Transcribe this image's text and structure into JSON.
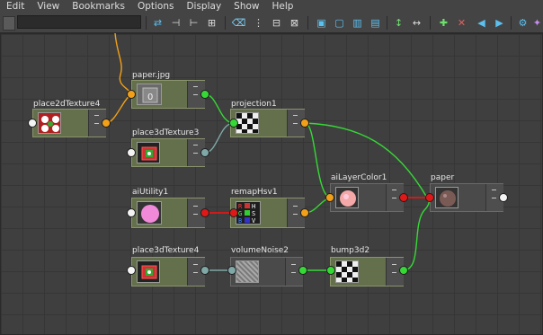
{
  "menubar": {
    "items": [
      "Edit",
      "View",
      "Bookmarks",
      "Options",
      "Display",
      "Show",
      "Help"
    ]
  },
  "toolbar": {
    "search_value": "",
    "icons": [
      "hypershade-swap-icon",
      "input-connections-icon",
      "output-connections-icon",
      "in-out-connections-icon",
      "clear-graph-icon",
      "rearrange-graph-icon",
      "graph-materials-icon",
      "graph-selection-icon",
      "show-inputs-icon",
      "show-outputs-icon",
      "show-both-icon",
      "show-none-icon",
      "align-vertical-icon",
      "align-horizontal-icon",
      "bookmark-add-icon",
      "bookmark-list-icon",
      "previous-view-icon",
      "next-view-icon",
      "frame-all-icon",
      "frame-selection-icon"
    ]
  },
  "nodes": [
    {
      "id": "paper_jpg",
      "title": "paper.jpg",
      "swatch": "file-image-swatch",
      "port_colors": {
        "in": "#f2a019",
        "out": "#36d836"
      }
    },
    {
      "id": "place2dTexture4",
      "title": "place2dTexture4",
      "swatch": "place2d-swatch",
      "port_colors": {
        "in": "#f4f4f4",
        "out": "#f2a019"
      }
    },
    {
      "id": "projection1",
      "title": "projection1",
      "swatch": "checker-swatch",
      "port_colors": {
        "in": "#36d836",
        "out": "#f2a019"
      }
    },
    {
      "id": "place3dTexture3",
      "title": "place3dTexture3",
      "swatch": "place3d-swatch",
      "port_colors": {
        "in": "#f4f4f4",
        "out": "#7fa8a6"
      }
    },
    {
      "id": "aiUtility1",
      "title": "aiUtility1",
      "swatch": "pink-sphere-swatch",
      "port_colors": {
        "in": "#f4f4f4",
        "out": "#e01818"
      }
    },
    {
      "id": "remapHsv1",
      "title": "remapHsv1",
      "swatch": "rgb-hsv-swatch",
      "port_colors": {
        "in": "#e01818",
        "out": "#f2a019"
      }
    },
    {
      "id": "aiLayerColor1",
      "title": "aiLayerColor1",
      "swatch": "layer-color-sphere-swatch",
      "port_colors": {
        "in": "#f2a019",
        "out": "#e01818"
      }
    },
    {
      "id": "paper",
      "title": "paper",
      "swatch": "material-sphere-swatch",
      "port_colors": {
        "in": "#e01818",
        "out": "#f4f4f4"
      }
    },
    {
      "id": "place3dTexture4",
      "title": "place3dTexture4",
      "swatch": "place3d-swatch",
      "port_colors": {
        "in": "#f4f4f4",
        "out": "#7fa8a6"
      }
    },
    {
      "id": "volumeNoise2",
      "title": "volumeNoise2",
      "swatch": "noise-swatch",
      "port_colors": {
        "in": "#7fa8a6",
        "out": "#36d836"
      }
    },
    {
      "id": "bump3d2",
      "title": "bump3d2",
      "swatch": "checker-swatch",
      "port_colors": {
        "in": "#36d836",
        "out": "#36d836"
      }
    }
  ],
  "rgb_hsv_letters": {
    "left": [
      "R",
      "G",
      "B"
    ],
    "right": [
      "H",
      "S",
      "V"
    ]
  },
  "connections": [
    {
      "from": "place2dTexture4",
      "to": "paper_jpg",
      "color": "#f2a019"
    },
    {
      "from": "paper_jpg",
      "to": "projection1",
      "color": "#36d836"
    },
    {
      "from": "place3dTexture3",
      "to": "projection1",
      "color": "#7fa8a6"
    },
    {
      "from": "projection1",
      "to": "aiLayerColor1",
      "color": "#36d836"
    },
    {
      "from": "projection1",
      "to": "paper",
      "color": "#36d836"
    },
    {
      "from": "aiUtility1",
      "to": "remapHsv1",
      "color": "#e01818"
    },
    {
      "from": "remapHsv1",
      "to": "aiLayerColor1",
      "color": "#36d836"
    },
    {
      "from": "aiLayerColor1",
      "to": "paper",
      "color": "#e01818"
    },
    {
      "from": "place3dTexture4",
      "to": "volumeNoise2",
      "color": "#7fa8a6"
    },
    {
      "from": "volumeNoise2",
      "to": "bump3d2",
      "color": "#36d836"
    },
    {
      "from": "bump3d2",
      "to": "paper",
      "color": "#36d836"
    }
  ],
  "colors": {
    "node_body": "#64704c",
    "graph_background": "#3f3f3f",
    "port_orange": "#f2a019",
    "port_green": "#36d836",
    "port_red": "#e01818",
    "port_teal": "#7fa8a6",
    "port_white": "#f4f4f4"
  }
}
